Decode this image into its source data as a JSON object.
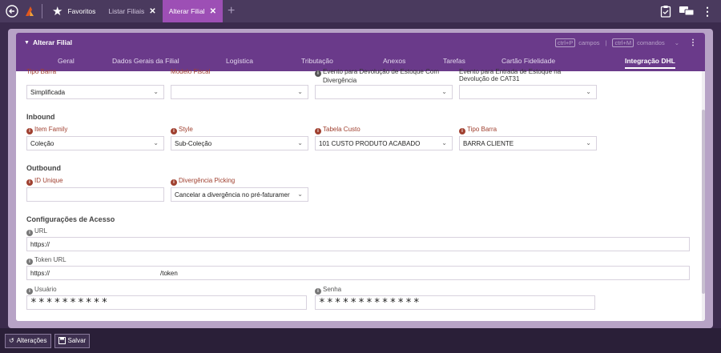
{
  "topbar": {
    "favorites_label": "Favoritos",
    "tabs": [
      {
        "label": "Listar Filiais",
        "close": "✕"
      },
      {
        "label": "Alterar Filial",
        "close": "✕"
      }
    ],
    "add_tab": "+"
  },
  "card": {
    "title": "Alterar Filial",
    "shortcut1": "ctrl+P",
    "shortcut1_text": "campos",
    "divider": "|",
    "shortcut2": "ctrl+M",
    "shortcut2_text": "comandos"
  },
  "tabs": [
    "Geral",
    "Dados Gerais da Filial",
    "Logística",
    "Tributação",
    "Anexos",
    "Tarefas",
    "Cartão Fidelidade",
    "Integração DHL"
  ],
  "active_tab": "Integração DHL",
  "top_fields": {
    "tipo_barra_label": "Tipo Barra",
    "tipo_barra_value": "Simplificada",
    "modelo_fiscal_label": "Modelo Fiscal",
    "evento_dev_label_1": "Evento para Devolução de Estoque Com",
    "evento_dev_label_2": "Divergência",
    "evento_entrada_label_1": "Evento para Entrada de Estoque na",
    "evento_entrada_label_2": "Devolução de CAT31"
  },
  "inbound": {
    "title": "Inbound",
    "item_family_label": "Item Family",
    "item_family_value": "Coleção",
    "style_label": "Style",
    "style_value": "Sub-Coleção",
    "tabela_custo_label": "Tabela Custo",
    "tabela_custo_value": "101 CUSTO PRODUTO ACABADO",
    "tipo_barra_label": "Tipo Barra",
    "tipo_barra_value": "BARRA CLIENTE"
  },
  "outbound": {
    "title": "Outbound",
    "id_unique_label": "ID Unique",
    "id_unique_value": "",
    "divergencia_label": "Divergência Picking",
    "divergencia_value": "Cancelar a divergência no pré-faturamer"
  },
  "acesso": {
    "title": "Configurações de Acesso",
    "url_label": "URL",
    "url_value": "https://",
    "token_url_label": "Token URL",
    "token_url_prefix": "https://",
    "token_url_suffix": "/token",
    "usuario_label": "Usuário",
    "usuario_value": "**********",
    "senha_label": "Senha",
    "senha_value": "*************"
  },
  "bottom": {
    "alteracoes_label": "Alterações",
    "salvar_label": "Salvar"
  },
  "colors": {
    "header": "#6a3a8a",
    "active_tab": "#9d4fb5",
    "required_label": "#a04030"
  }
}
